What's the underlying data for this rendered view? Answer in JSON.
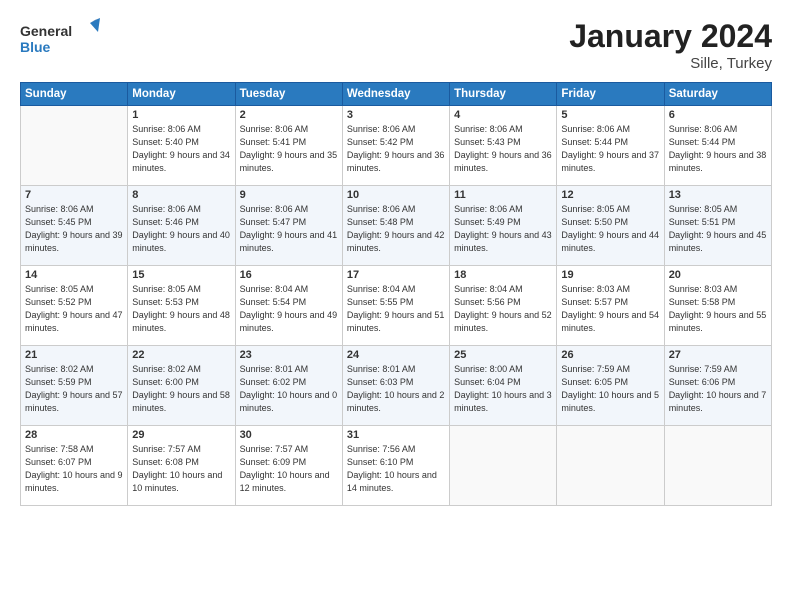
{
  "header": {
    "logo_general": "General",
    "logo_blue": "Blue",
    "title": "January 2024",
    "location": "Sille, Turkey"
  },
  "weekdays": [
    "Sunday",
    "Monday",
    "Tuesday",
    "Wednesday",
    "Thursday",
    "Friday",
    "Saturday"
  ],
  "weeks": [
    [
      {
        "day": "",
        "info": ""
      },
      {
        "day": "1",
        "info": "Sunrise: 8:06 AM\nSunset: 5:40 PM\nDaylight: 9 hours\nand 34 minutes."
      },
      {
        "day": "2",
        "info": "Sunrise: 8:06 AM\nSunset: 5:41 PM\nDaylight: 9 hours\nand 35 minutes."
      },
      {
        "day": "3",
        "info": "Sunrise: 8:06 AM\nSunset: 5:42 PM\nDaylight: 9 hours\nand 36 minutes."
      },
      {
        "day": "4",
        "info": "Sunrise: 8:06 AM\nSunset: 5:43 PM\nDaylight: 9 hours\nand 36 minutes."
      },
      {
        "day": "5",
        "info": "Sunrise: 8:06 AM\nSunset: 5:44 PM\nDaylight: 9 hours\nand 37 minutes."
      },
      {
        "day": "6",
        "info": "Sunrise: 8:06 AM\nSunset: 5:44 PM\nDaylight: 9 hours\nand 38 minutes."
      }
    ],
    [
      {
        "day": "7",
        "info": ""
      },
      {
        "day": "8",
        "info": "Sunrise: 8:06 AM\nSunset: 5:46 PM\nDaylight: 9 hours\nand 40 minutes."
      },
      {
        "day": "9",
        "info": "Sunrise: 8:06 AM\nSunset: 5:47 PM\nDaylight: 9 hours\nand 41 minutes."
      },
      {
        "day": "10",
        "info": "Sunrise: 8:06 AM\nSunset: 5:48 PM\nDaylight: 9 hours\nand 42 minutes."
      },
      {
        "day": "11",
        "info": "Sunrise: 8:06 AM\nSunset: 5:49 PM\nDaylight: 9 hours\nand 43 minutes."
      },
      {
        "day": "12",
        "info": "Sunrise: 8:05 AM\nSunset: 5:50 PM\nDaylight: 9 hours\nand 44 minutes."
      },
      {
        "day": "13",
        "info": "Sunrise: 8:05 AM\nSunset: 5:51 PM\nDaylight: 9 hours\nand 45 minutes."
      }
    ],
    [
      {
        "day": "14",
        "info": ""
      },
      {
        "day": "15",
        "info": "Sunrise: 8:05 AM\nSunset: 5:53 PM\nDaylight: 9 hours\nand 48 minutes."
      },
      {
        "day": "16",
        "info": "Sunrise: 8:04 AM\nSunset: 5:54 PM\nDaylight: 9 hours\nand 49 minutes."
      },
      {
        "day": "17",
        "info": "Sunrise: 8:04 AM\nSunset: 5:55 PM\nDaylight: 9 hours\nand 51 minutes."
      },
      {
        "day": "18",
        "info": "Sunrise: 8:04 AM\nSunset: 5:56 PM\nDaylight: 9 hours\nand 52 minutes."
      },
      {
        "day": "19",
        "info": "Sunrise: 8:03 AM\nSunset: 5:57 PM\nDaylight: 9 hours\nand 54 minutes."
      },
      {
        "day": "20",
        "info": "Sunrise: 8:03 AM\nSunset: 5:58 PM\nDaylight: 9 hours\nand 55 minutes."
      }
    ],
    [
      {
        "day": "21",
        "info": ""
      },
      {
        "day": "22",
        "info": "Sunrise: 8:02 AM\nSunset: 6:00 PM\nDaylight: 9 hours\nand 58 minutes."
      },
      {
        "day": "23",
        "info": "Sunrise: 8:01 AM\nSunset: 6:02 PM\nDaylight: 10 hours\nand 0 minutes."
      },
      {
        "day": "24",
        "info": "Sunrise: 8:01 AM\nSunset: 6:03 PM\nDaylight: 10 hours\nand 2 minutes."
      },
      {
        "day": "25",
        "info": "Sunrise: 8:00 AM\nSunset: 6:04 PM\nDaylight: 10 hours\nand 3 minutes."
      },
      {
        "day": "26",
        "info": "Sunrise: 7:59 AM\nSunset: 6:05 PM\nDaylight: 10 hours\nand 5 minutes."
      },
      {
        "day": "27",
        "info": "Sunrise: 7:59 AM\nSunset: 6:06 PM\nDaylight: 10 hours\nand 7 minutes."
      }
    ],
    [
      {
        "day": "28",
        "info": ""
      },
      {
        "day": "29",
        "info": "Sunrise: 7:57 AM\nSunset: 6:08 PM\nDaylight: 10 hours\nand 10 minutes."
      },
      {
        "day": "30",
        "info": "Sunrise: 7:57 AM\nSunset: 6:09 PM\nDaylight: 10 hours\nand 12 minutes."
      },
      {
        "day": "31",
        "info": "Sunrise: 7:56 AM\nSunset: 6:10 PM\nDaylight: 10 hours\nand 14 minutes."
      },
      {
        "day": "",
        "info": ""
      },
      {
        "day": "",
        "info": ""
      },
      {
        "day": "",
        "info": ""
      }
    ]
  ],
  "week1_sun": "Sunrise: 8:06 AM\nSunset: 5:45 PM\nDaylight: 9 hours\nand 39 minutes.",
  "week3_sun": "Sunrise: 8:05 AM\nSunset: 5:52 PM\nDaylight: 9 hours\nand 47 minutes.",
  "week4_sun": "Sunrise: 8:02 AM\nSunset: 5:59 PM\nDaylight: 9 hours\nand 57 minutes.",
  "week5_sun": "Sunrise: 7:58 AM\nSunset: 6:07 PM\nDaylight: 10 hours\nand 9 minutes."
}
